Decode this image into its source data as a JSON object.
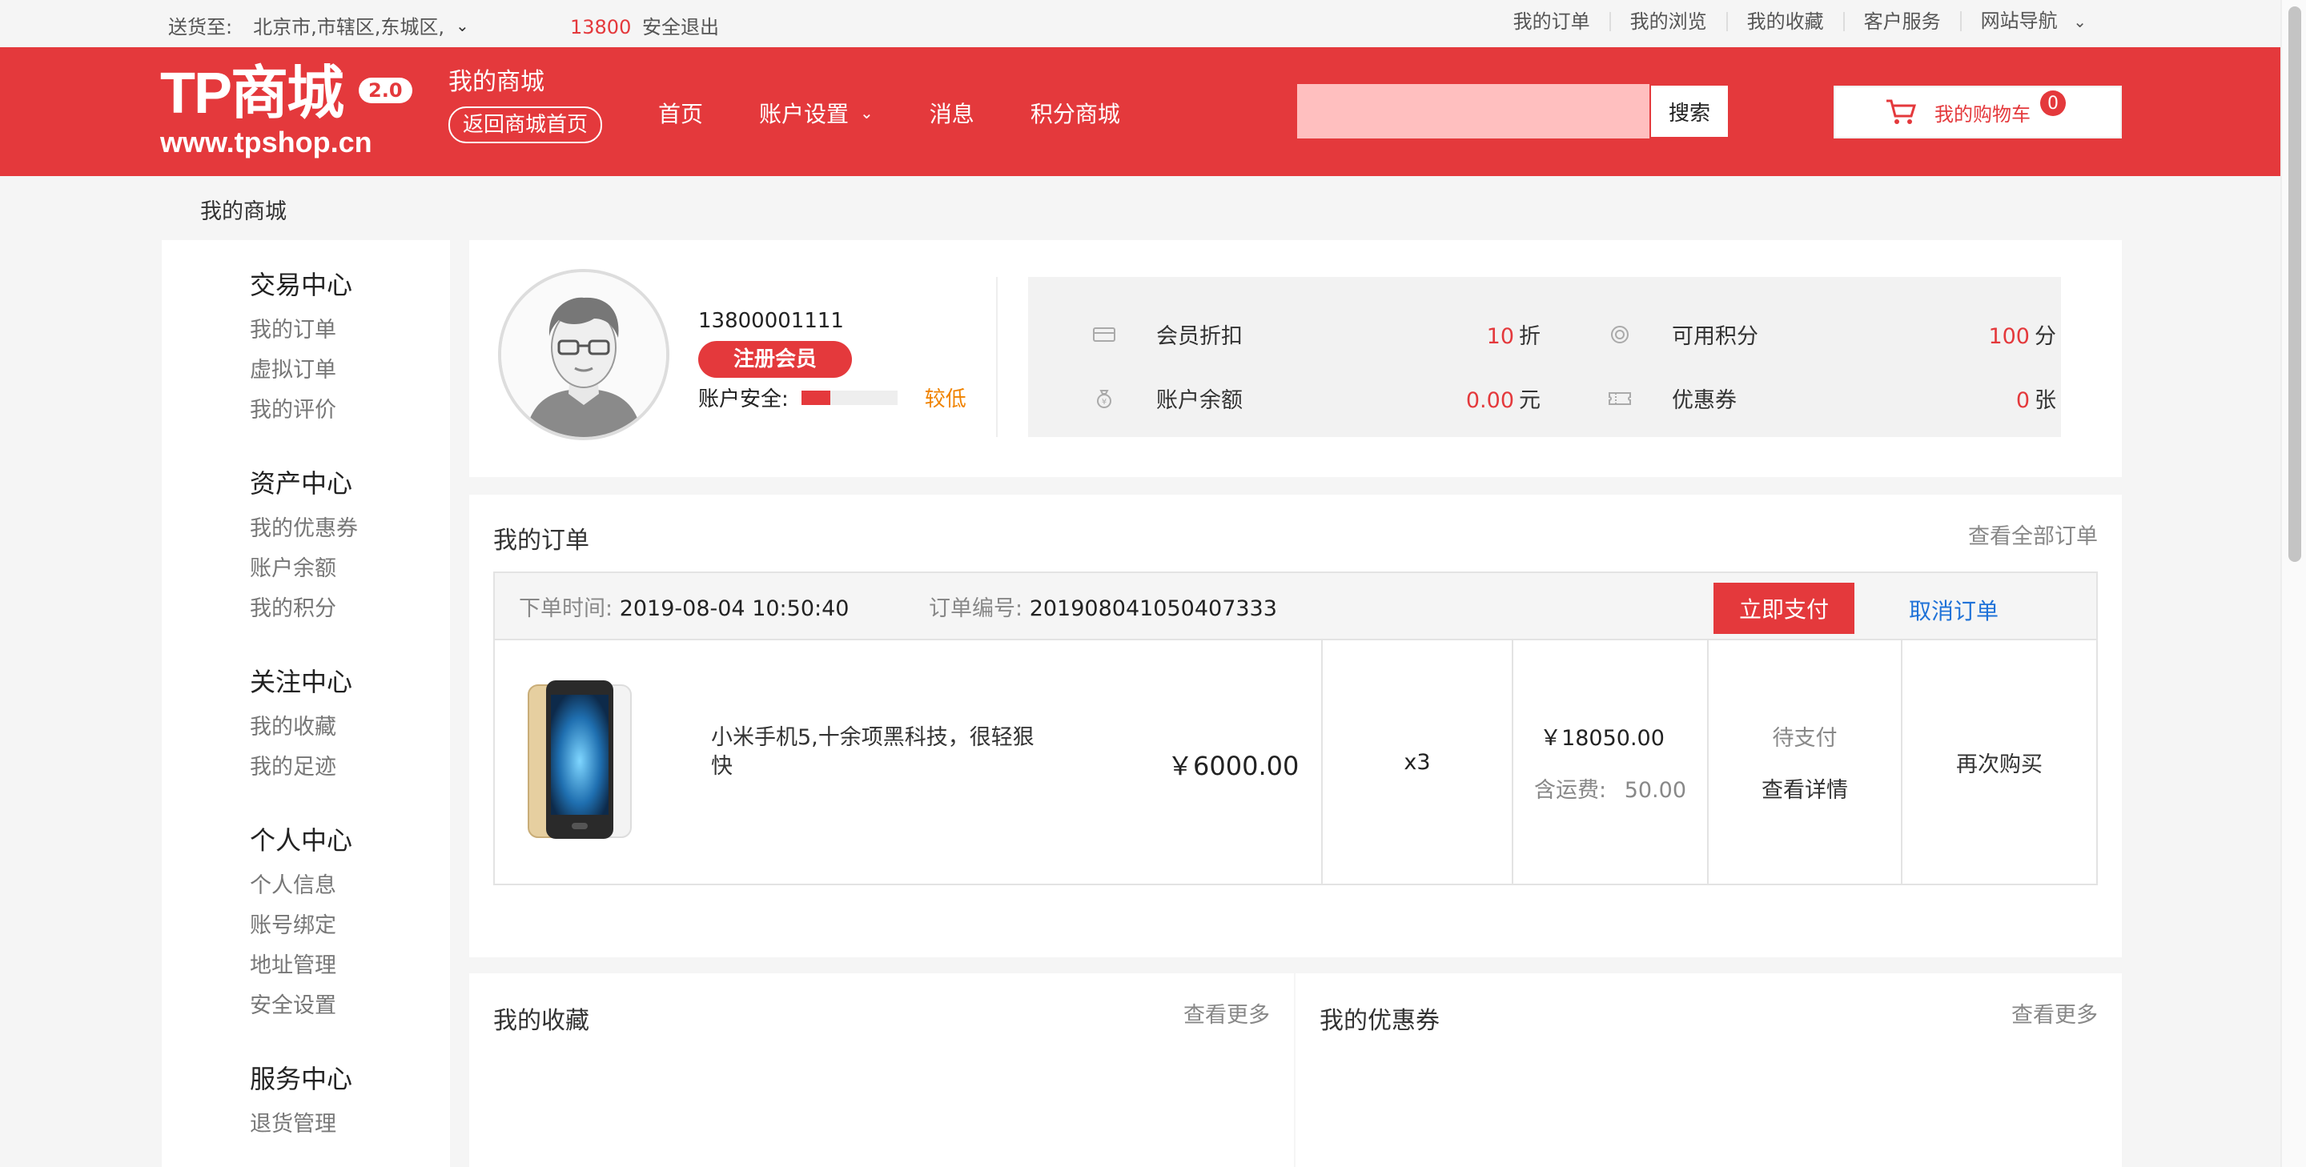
{
  "topbar": {
    "ship_label": "送货至:",
    "location": "北京市,市辖区,东城区,",
    "phone": "13800",
    "logout": "安全退出",
    "links": [
      "我的订单",
      "我的浏览",
      "我的收藏",
      "客户服务",
      "网站导航"
    ]
  },
  "header": {
    "logo_main": "TP商城",
    "logo_version": "2.0",
    "logo_url": "www.tpshop.cn",
    "my_mall": "我的商城",
    "back_home": "返回商城首页",
    "nav": [
      "首页",
      "账户设置",
      "消息",
      "积分商城"
    ],
    "search_placeholder": "",
    "search_button": "搜索",
    "cart_label": "我的购物车",
    "cart_count": "0"
  },
  "breadcrumb": "我的商城",
  "sidebar": {
    "groups": [
      {
        "title": "交易中心",
        "items": [
          "我的订单",
          "虚拟订单",
          "我的评价"
        ]
      },
      {
        "title": "资产中心",
        "items": [
          "我的优惠券",
          "账户余额",
          "我的积分"
        ]
      },
      {
        "title": "关注中心",
        "items": [
          "我的收藏",
          "我的足迹"
        ]
      },
      {
        "title": "个人中心",
        "items": [
          "个人信息",
          "账号绑定",
          "地址管理",
          "安全设置"
        ]
      },
      {
        "title": "服务中心",
        "items": [
          "退货管理"
        ]
      }
    ]
  },
  "user": {
    "phone": "13800001111",
    "member_badge": "注册会员",
    "security_label": "账户安全:",
    "security_level": "较低",
    "security_fill": 0.3
  },
  "stats": {
    "discount": {
      "label": "会员折扣",
      "value": "10",
      "unit": "折"
    },
    "points": {
      "label": "可用积分",
      "value": "100",
      "unit": "分"
    },
    "balance": {
      "label": "账户余额",
      "value": "0.00",
      "unit": "元"
    },
    "coupons": {
      "label": "优惠券",
      "value": "0",
      "unit": "张"
    }
  },
  "orders": {
    "title": "我的订单",
    "view_all": "查看全部订单",
    "order": {
      "time_label": "下单时间:",
      "time": "2019-08-04 10:50:40",
      "sn_label": "订单编号:",
      "sn": "201908041050407333",
      "pay_button": "立即支付",
      "cancel_button": "取消订单",
      "product_name": "小米手机5,十余项黑科技，很轻狠快",
      "unit_price": "￥6000.00",
      "quantity": "x3",
      "total": "￥18050.00",
      "shipping_label": "含运费:",
      "shipping": "50.00",
      "status": "待支付",
      "details": "查看详情",
      "buy_again": "再次购买"
    }
  },
  "favorites": {
    "title": "我的收藏",
    "more": "查看更多"
  },
  "coupons_panel": {
    "title": "我的优惠券",
    "more": "查看更多"
  },
  "colors": {
    "brand": "#e4393c",
    "link": "#1f72d8",
    "warning": "#f08300"
  }
}
